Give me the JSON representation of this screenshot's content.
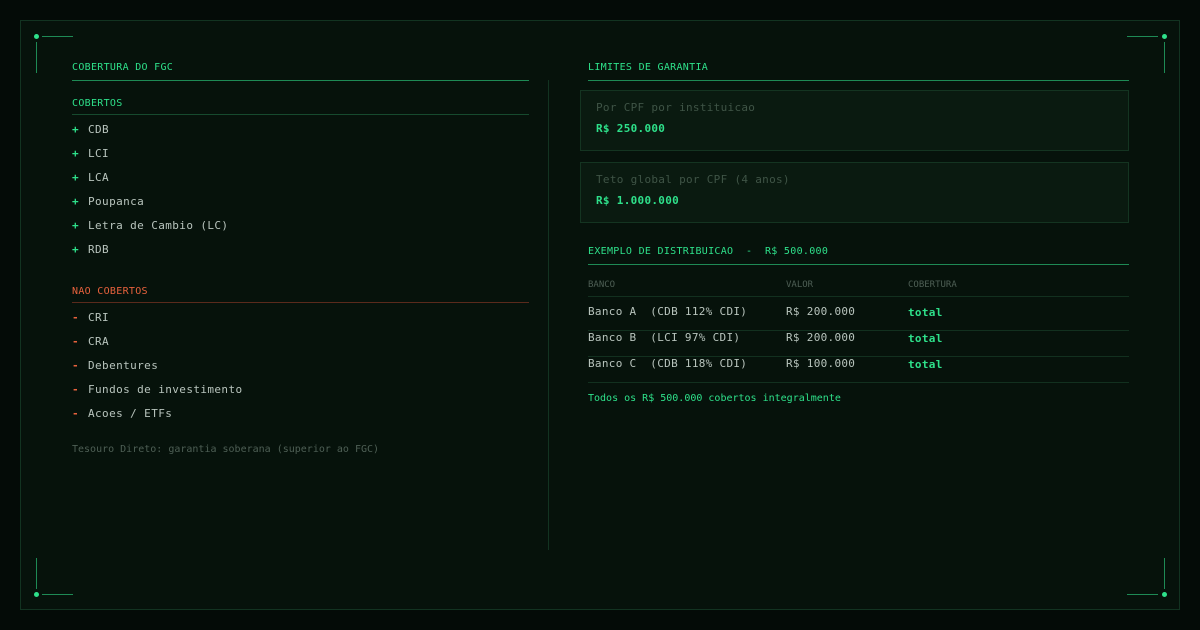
{
  "left": {
    "title": "COBERTURA DO FGC",
    "covered": {
      "title": "COBERTOS",
      "marker": "+",
      "items": [
        "CDB",
        "LCI",
        "LCA",
        "Poupanca",
        "Letra de Cambio (LC)",
        "RDB"
      ]
    },
    "not_covered": {
      "title": "NAO COBERTOS",
      "marker": "-",
      "items": [
        "CRI",
        "CRA",
        "Debentures",
        "Fundos de investimento",
        "Acoes / ETFs"
      ]
    },
    "note": "Tesouro Direto: garantia soberana (superior ao FGC)"
  },
  "right": {
    "title": "LIMITES DE GARANTIA",
    "limits": [
      {
        "label": "Por CPF por instituicao",
        "value": "R$ 250.000"
      },
      {
        "label": "Teto global por CPF (4 anos)",
        "value": "R$ 1.000.000"
      }
    ],
    "example": {
      "title": "EXEMPLO DE DISTRIBUICAO  -  R$ 500.000",
      "headers": [
        "BANCO",
        "VALOR",
        "COBERTURA"
      ],
      "rows": [
        {
          "bank": "Banco A  (CDB 112% CDI)",
          "value": "R$ 200.000",
          "coverage": "total"
        },
        {
          "bank": "Banco B  (LCI 97% CDI)",
          "value": "R$ 200.000",
          "coverage": "total"
        },
        {
          "bank": "Banco C  (CDB 118% CDI)",
          "value": "R$ 100.000",
          "coverage": "total"
        }
      ],
      "summary": "Todos os R$ 500.000 cobertos integralmente"
    }
  },
  "colors": {
    "accent": "#2ee08a",
    "negative": "#e8623d",
    "background": "#06120b"
  }
}
